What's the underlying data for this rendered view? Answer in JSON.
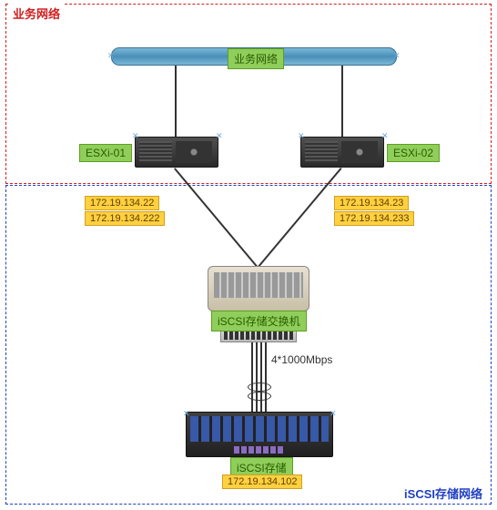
{
  "zones": {
    "business": {
      "label": "业务网络",
      "color": "#d02020"
    },
    "iscsi": {
      "label": "iSCSI存储网络",
      "color": "#2040c0"
    }
  },
  "network_bar": {
    "label": "业务网络"
  },
  "hosts": {
    "esxi01": {
      "name": "ESXi-01",
      "ips": [
        "172.19.134.22",
        "172.19.134.222"
      ]
    },
    "esxi02": {
      "name": "ESXi-02",
      "ips": [
        "172.19.134.23",
        "172.19.134.233"
      ]
    }
  },
  "switch": {
    "label": "iSCSI存储交换机"
  },
  "link": {
    "label": "4*1000Mbps"
  },
  "storage": {
    "label": "iSCSI存储",
    "ip": "172.19.134.102"
  }
}
